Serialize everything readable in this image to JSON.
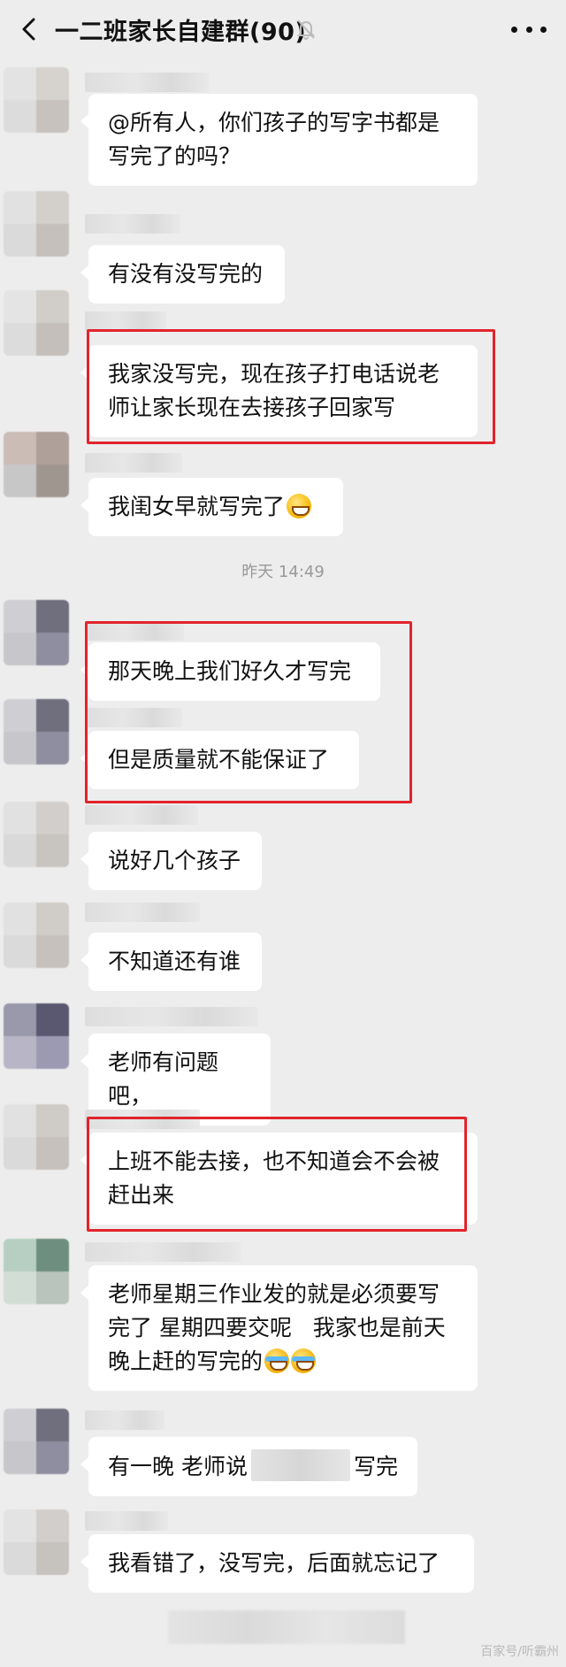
{
  "header": {
    "title": "一二班家长自建群(90)"
  },
  "timestamp": "昨天 14:49",
  "messages": [
    {
      "id": "m1",
      "text": "@所有人，你们孩子的写字书都是\n写完了的吗？"
    },
    {
      "id": "m2",
      "text": "有没有没写完的"
    },
    {
      "id": "m3",
      "text": "我家没写完，现在孩子打电话说老\n师让家长现在去接孩子回家写"
    },
    {
      "id": "m4",
      "text": "我闺女早就写完了"
    },
    {
      "id": "m5",
      "text": "那天晚上我们好久才写完"
    },
    {
      "id": "m6",
      "text": "但是质量就不能保证了"
    },
    {
      "id": "m7",
      "text": "说好几个孩子"
    },
    {
      "id": "m8",
      "text": "不知道还有谁"
    },
    {
      "id": "m9",
      "text": "老师有问题吧，"
    },
    {
      "id": "m10",
      "text": "上班不能去接，也不知道会不会被\n赶出来"
    },
    {
      "id": "m11",
      "text": "老师星期三作业发的就是必须要写\n完了 星期四要交呢   我家也是前天\n晚上赶的写完的"
    },
    {
      "id": "m12",
      "text_before": "有一晚 老师说",
      "text_after": "写完"
    },
    {
      "id": "m13",
      "text": "我看错了，没写完，后面就忘记了"
    }
  ],
  "watermark": "百家号/听霸州",
  "colors": {
    "background": "#ededed",
    "bubble": "#ffffff",
    "highlight_box": "#e1242c",
    "timestamp_text": "#999999"
  },
  "icons": [
    "back-chevron-icon",
    "bell-muted-icon",
    "more-dots-icon",
    "grinning-emoji-icon",
    "crying-laughing-emoji-icon"
  ]
}
